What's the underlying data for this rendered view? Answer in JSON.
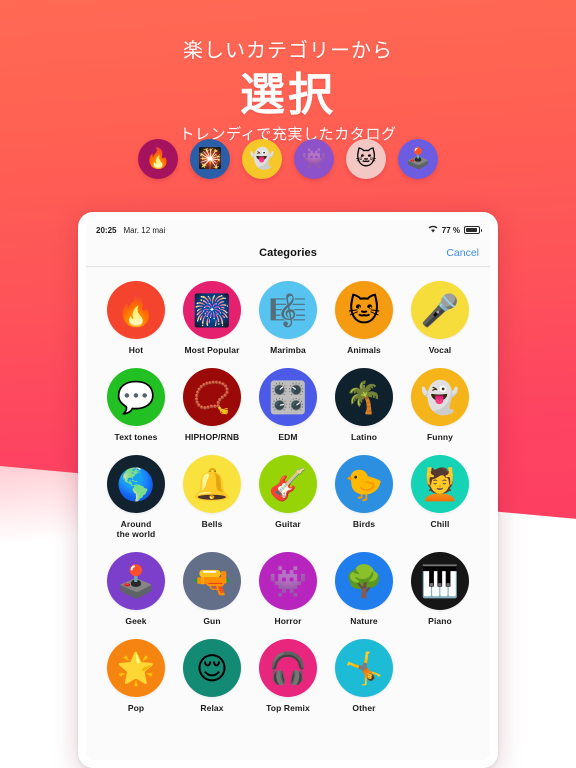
{
  "promo": {
    "kicker": "楽しいカテゴリーから",
    "title": "選択",
    "subtitle": "トレンディで充実したカタログ",
    "icons": [
      {
        "name": "fire-icon",
        "glyph": "🔥",
        "bg": "#A5135F"
      },
      {
        "name": "sparkle-icon",
        "glyph": "🎇",
        "bg": "#2B5EA8"
      },
      {
        "name": "ghost-icon",
        "glyph": "👻",
        "bg": "#F6C728"
      },
      {
        "name": "monster-icon",
        "glyph": "👾",
        "bg": "#8D52C9"
      },
      {
        "name": "cat-face-icon",
        "glyph": "🐱",
        "bg": "#F3C8C4"
      },
      {
        "name": "joystick-icon",
        "glyph": "🕹️",
        "bg": "#6B5CE2"
      }
    ]
  },
  "device": {
    "statusbar": {
      "time": "20:25",
      "date": "Mar. 12 mai",
      "battery_percent": "77 %",
      "wifi_icon": "wifi-icon",
      "battery_icon": "battery-icon"
    },
    "navbar": {
      "title": "Categories",
      "cancel_label": "Cancel",
      "cancel_color": "#3C8DF0"
    }
  },
  "categories": [
    {
      "label": "Hot",
      "glyph": "🔥",
      "bg": "#F4442E",
      "icon_name": "fire-icon"
    },
    {
      "label": "Most Popular",
      "glyph": "🎆",
      "bg": "#E4206F",
      "icon_name": "starburst-icon"
    },
    {
      "label": "Marimba",
      "glyph": "🎼",
      "bg": "#56C3F0",
      "icon_name": "marimba-icon"
    },
    {
      "label": "Animals",
      "glyph": "🐱",
      "bg": "#F59B12",
      "icon_name": "cat-face-icon"
    },
    {
      "label": "Vocal",
      "glyph": "🎤",
      "bg": "#F7DD3C",
      "icon_name": "microphone-icon"
    },
    {
      "label": "Text tones",
      "glyph": "💬",
      "bg": "#23C023",
      "icon_name": "speech-bubble-icon"
    },
    {
      "label": "HIPHOP/RNB",
      "glyph": "📿",
      "bg": "#9C0909",
      "icon_name": "gold-chain-icon"
    },
    {
      "label": "EDM",
      "glyph": "🎛️",
      "bg": "#4B5BE8",
      "icon_name": "knob-icon"
    },
    {
      "label": "Latino",
      "glyph": "🌴",
      "bg": "#10212E",
      "icon_name": "palm-tree-icon"
    },
    {
      "label": "Funny",
      "glyph": "👻",
      "bg": "#F4B41A",
      "icon_name": "ghost-icon"
    },
    {
      "label": "Around\nthe world",
      "glyph": "🌎",
      "bg": "#12222E",
      "icon_name": "globe-icon"
    },
    {
      "label": "Bells",
      "glyph": "🔔",
      "bg": "#F9E23D",
      "icon_name": "bell-icon"
    },
    {
      "label": "Guitar",
      "glyph": "🎸",
      "bg": "#97D407",
      "icon_name": "guitar-icon"
    },
    {
      "label": "Birds",
      "glyph": "🐤",
      "bg": "#2D8FE0",
      "icon_name": "chick-icon"
    },
    {
      "label": "Chill",
      "glyph": "💆",
      "bg": "#15D3B4",
      "icon_name": "spa-face-icon"
    },
    {
      "label": "Geek",
      "glyph": "🕹️",
      "bg": "#7B3FCB",
      "icon_name": "joystick-icon"
    },
    {
      "label": "Gun",
      "glyph": "🔫",
      "bg": "#636E88",
      "icon_name": "pistol-icon"
    },
    {
      "label": "Horror",
      "glyph": "👾",
      "bg": "#B724BE",
      "icon_name": "monster-icon"
    },
    {
      "label": "Nature",
      "glyph": "🌳",
      "bg": "#1F7DEC",
      "icon_name": "tree-icon"
    },
    {
      "label": "Piano",
      "glyph": "🎹",
      "bg": "#161616",
      "icon_name": "piano-icon"
    },
    {
      "label": "Pop",
      "glyph": "🌟",
      "bg": "#F58410",
      "icon_name": "shooting-star-icon"
    },
    {
      "label": "Relax",
      "glyph": "😌",
      "bg": "#138A74",
      "icon_name": "sleeping-face-icon"
    },
    {
      "label": "Top Remix",
      "glyph": "🎧",
      "bg": "#E8267E",
      "icon_name": "headphones-icon"
    },
    {
      "label": "Other",
      "glyph": "🤸",
      "bg": "#1EBBD7",
      "icon_name": "cartwheel-icon"
    }
  ]
}
